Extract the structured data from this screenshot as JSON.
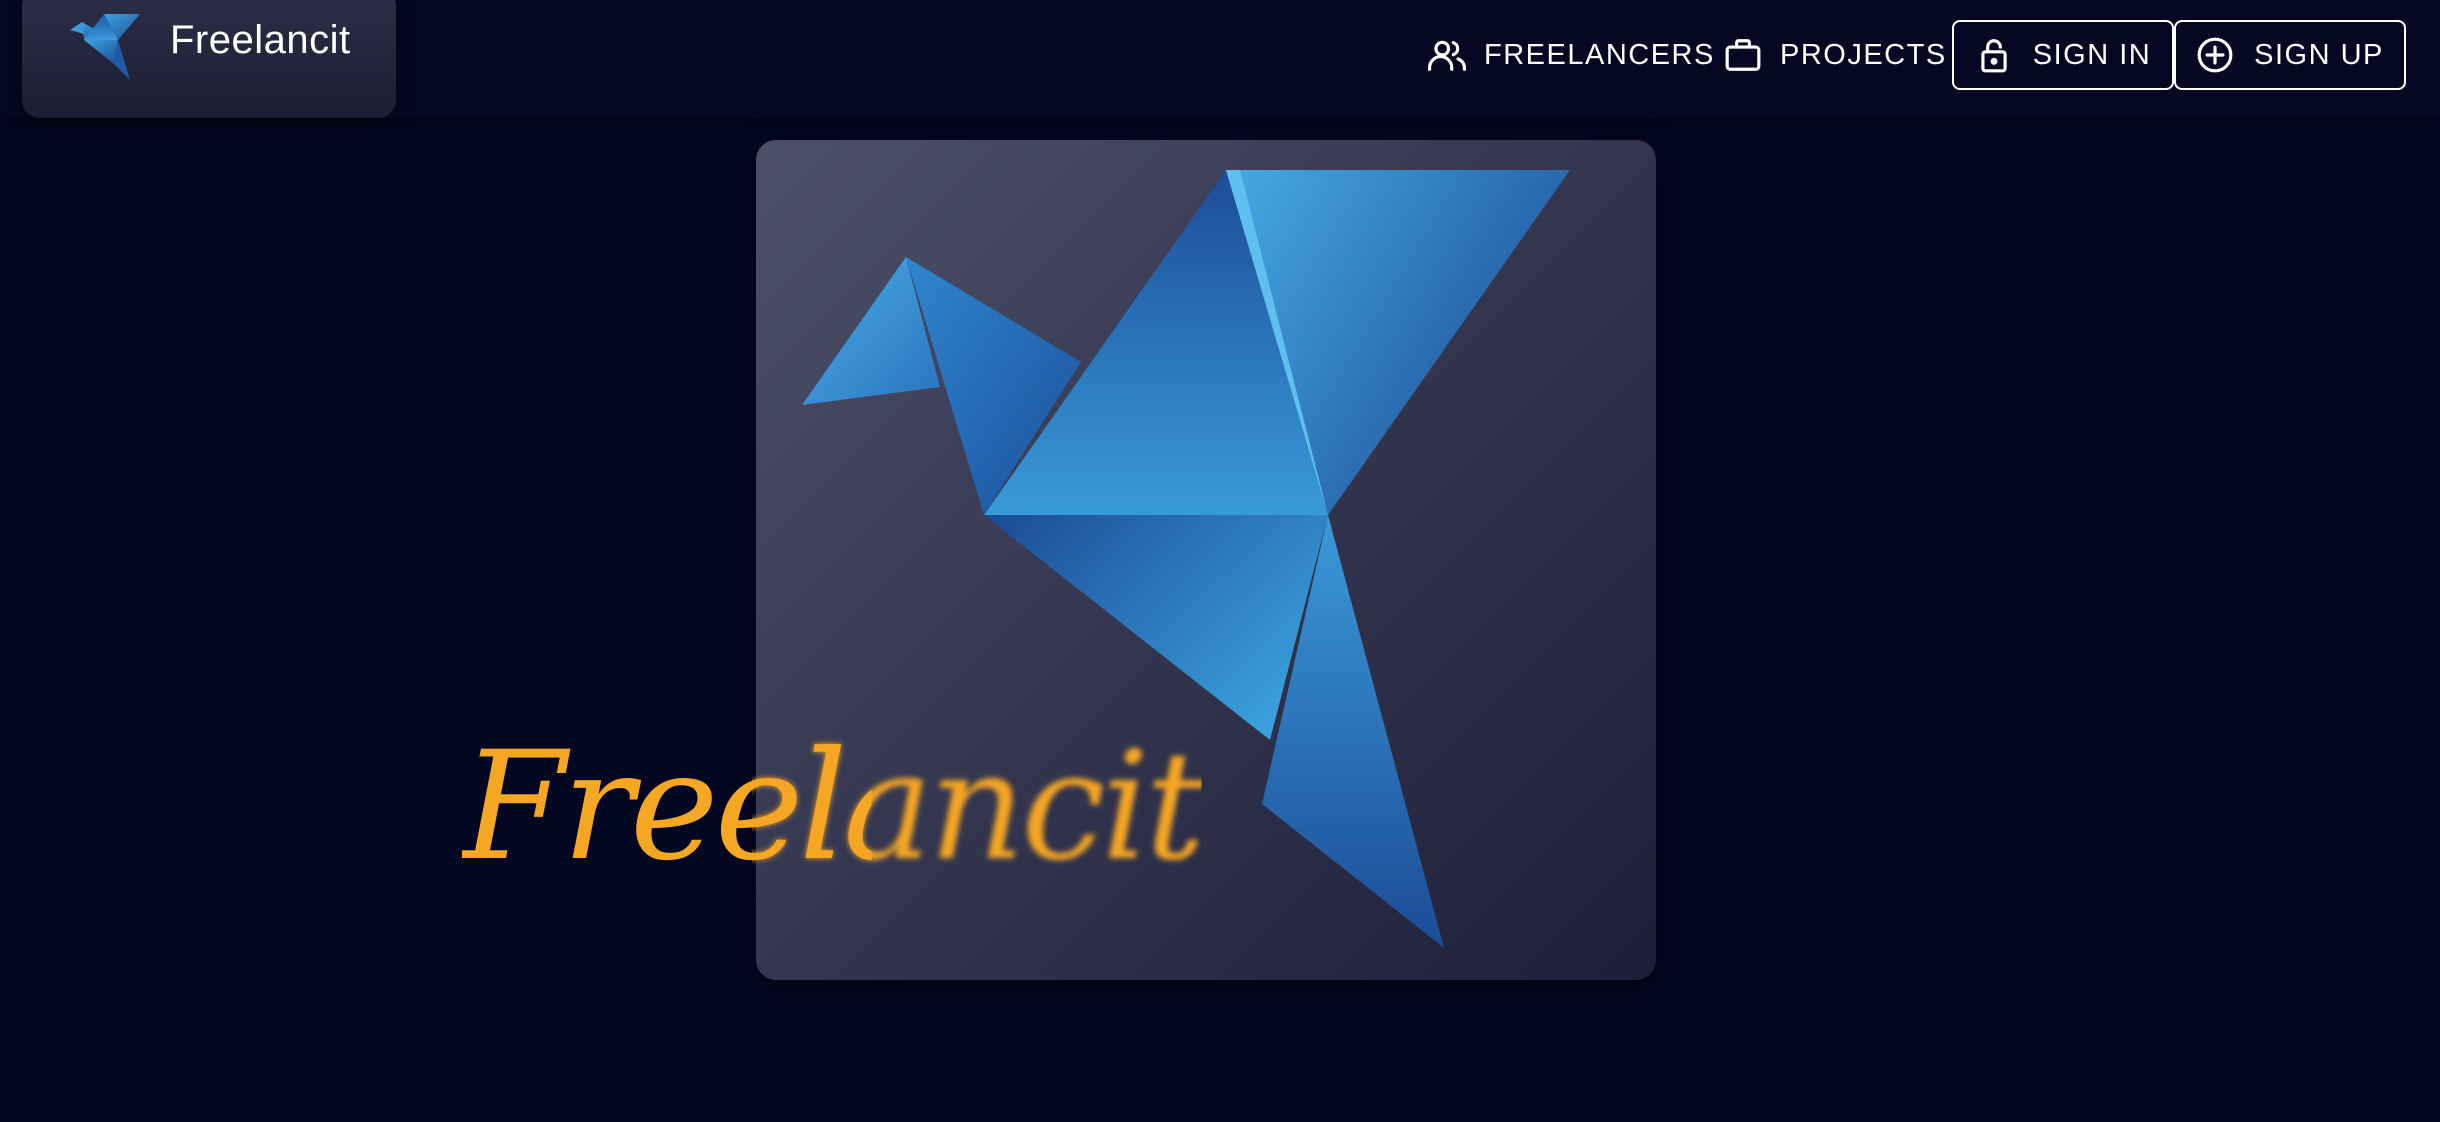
{
  "brand": {
    "name": "Freelancit",
    "logo_icon": "origami-bird-icon"
  },
  "nav": {
    "freelancers": {
      "label": "FREELANCERS",
      "icon": "users-icon"
    },
    "projects": {
      "label": "PROJECTS",
      "icon": "briefcase-icon"
    },
    "sign_in": {
      "label": "SIGN IN",
      "icon": "lock-icon"
    },
    "sign_up": {
      "label": "SIGN UP",
      "icon": "plus-circle-icon"
    }
  },
  "hero": {
    "illustration": "origami-bird-icon",
    "wordmark": "Freelancit"
  },
  "colors": {
    "background": "#040722",
    "accent_gold": "#f5a623",
    "bird_blue": "#2f8fd6"
  }
}
